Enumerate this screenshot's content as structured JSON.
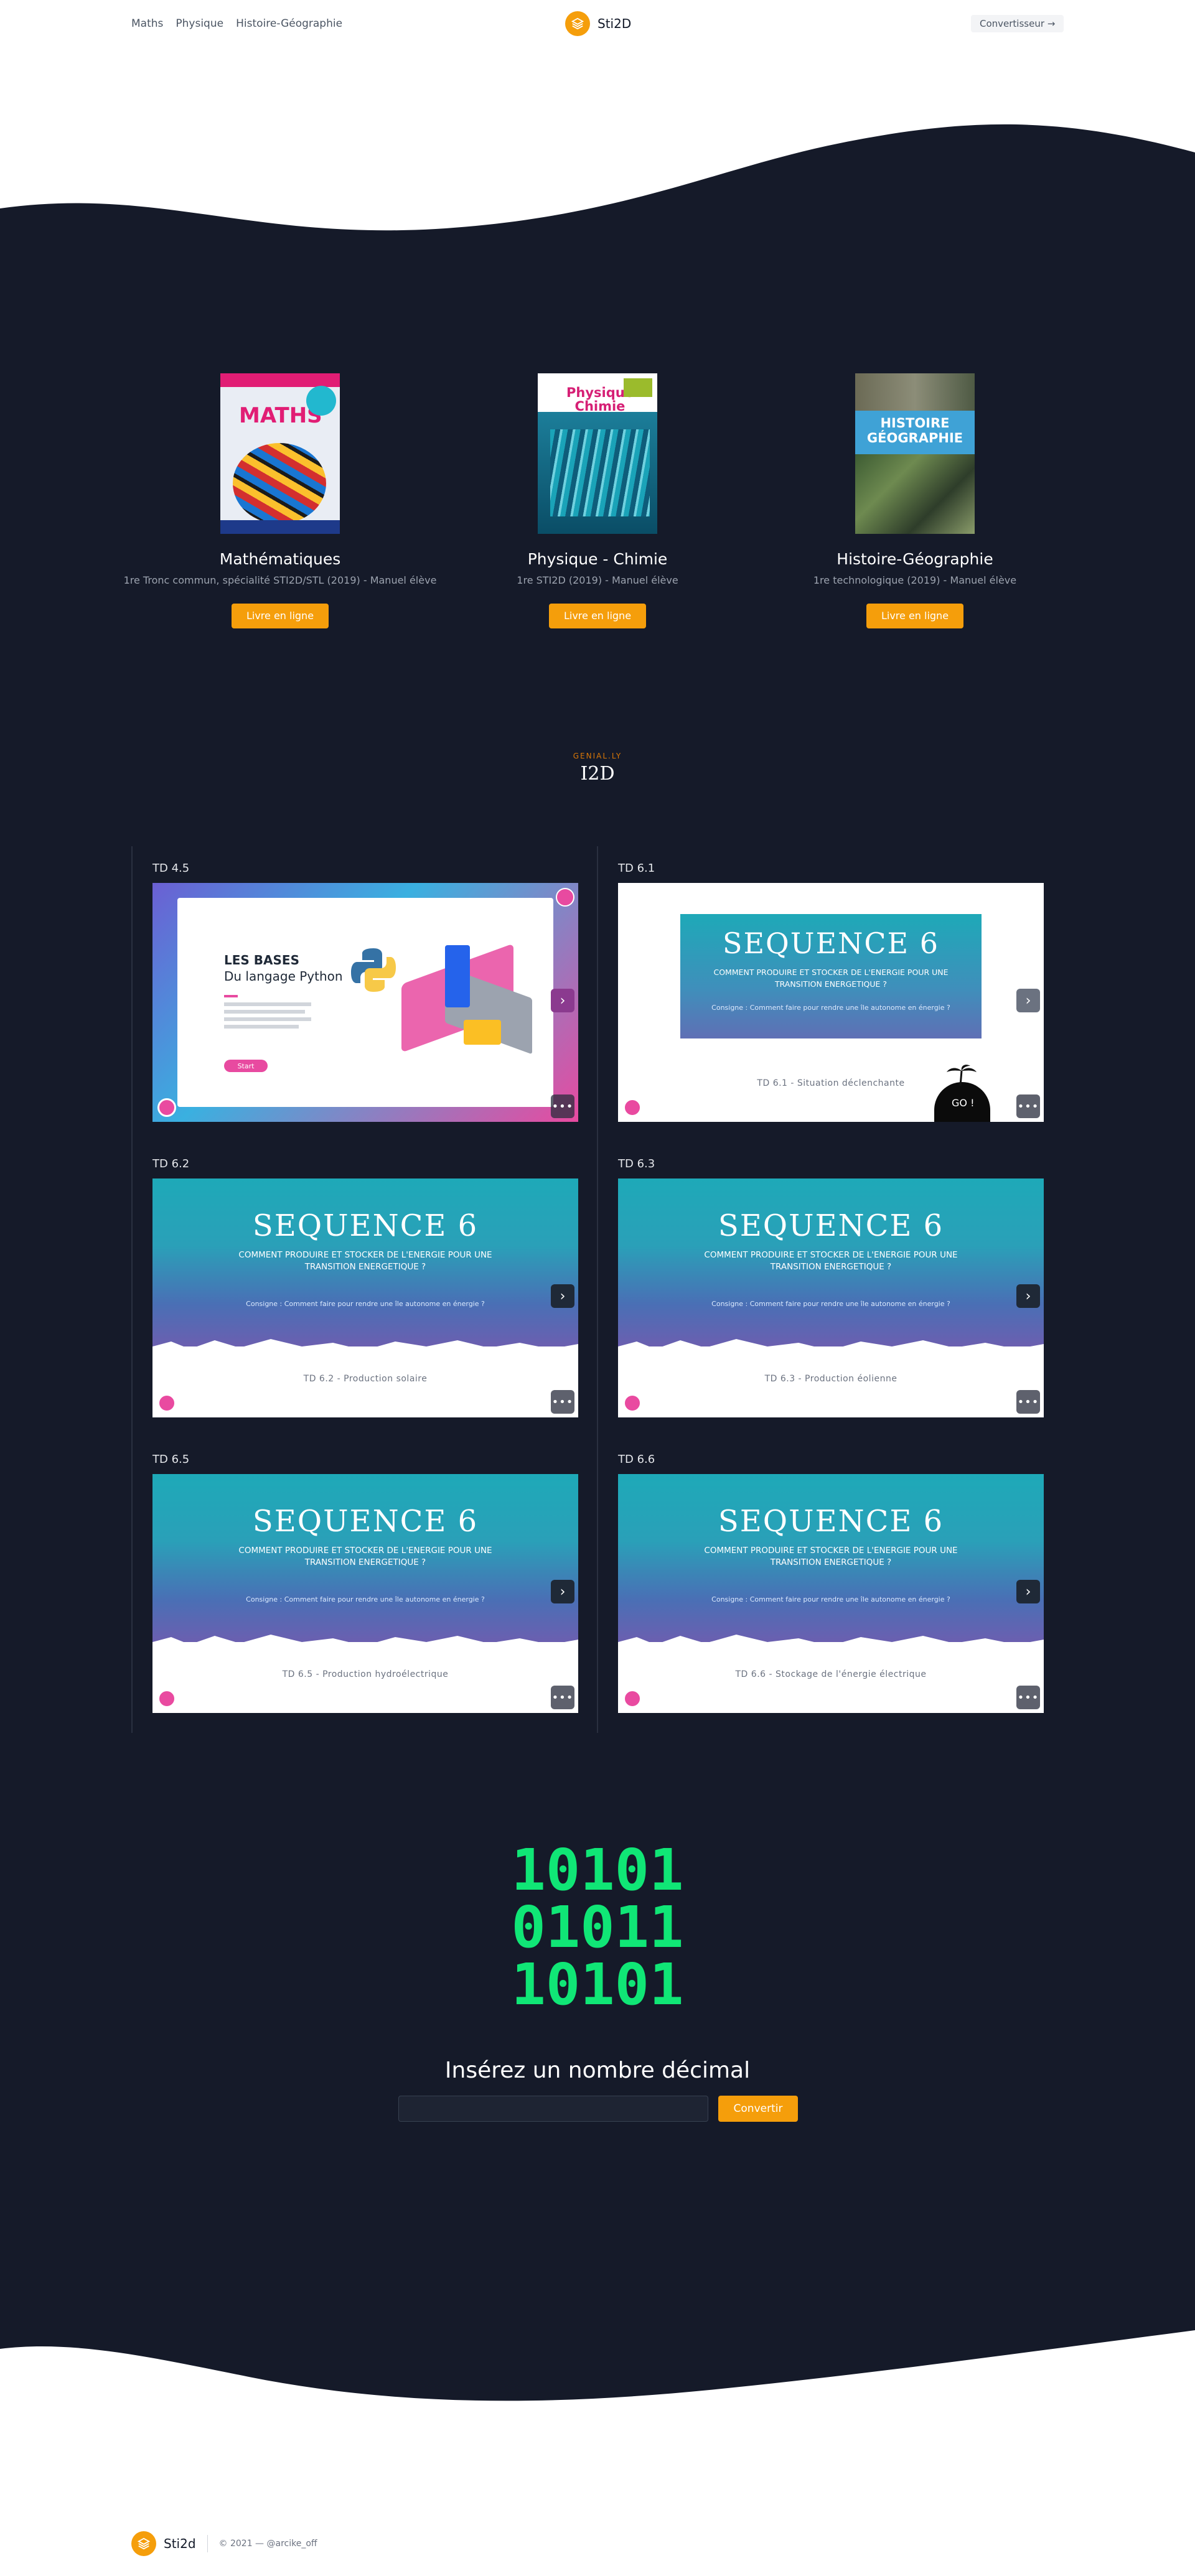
{
  "header": {
    "nav": [
      "Maths",
      "Physique",
      "Histoire-Géographie"
    ],
    "brand": "Sti2D",
    "converter_button": "Convertisseur →"
  },
  "books": [
    {
      "title": "Mathématiques",
      "subtitle": "1re Tronc commun, spécialité STI2D/STL (2019) - Manuel élève",
      "button": "Livre en ligne",
      "cover_text": "MATHS"
    },
    {
      "title": "Physique - Chimie",
      "subtitle": "1re STI2D (2019) - Manuel élève",
      "button": "Livre en ligne",
      "cover_text": "Physique Chimie"
    },
    {
      "title": "Histoire-Géographie",
      "subtitle": "1re technologique (2019) - Manuel élève",
      "button": "Livre en ligne",
      "cover_text": "HISTOIRE GÉOGRAPHIE"
    }
  ],
  "genial": {
    "eyebrow": "GENIAL.LY",
    "title": "I2D"
  },
  "td_cards": [
    {
      "label": "TD 4.5",
      "kind": "python",
      "slide_title": "LES BASES",
      "slide_subtitle": "Du langage Python",
      "slide_button": "Start"
    },
    {
      "label": "TD 6.1",
      "kind": "sequence",
      "seq_title": "SEQUENCE 6",
      "seq_sub": "Comment produire et stocker de l'energie pour une transition energetique ?",
      "seq_q": "Consigne : Comment faire pour rendre une île autonome en énergie ?",
      "footer": "TD 6.1 - Situation déclenchante",
      "go": "GO !"
    },
    {
      "label": "TD 6.2",
      "kind": "sequence",
      "seq_title": "SEQUENCE 6",
      "seq_sub": "Comment produire et stocker de l'energie pour une transition energetique ?",
      "seq_q": "Consigne : Comment faire pour rendre une île autonome en énergie ?",
      "footer": "TD 6.2 - Production solaire"
    },
    {
      "label": "TD 6.3",
      "kind": "sequence",
      "seq_title": "SEQUENCE 6",
      "seq_sub": "Comment produire et stocker de l'energie pour une transition energetique ?",
      "seq_q": "Consigne : Comment faire pour rendre une île autonome en énergie ?",
      "footer": "TD 6.3 - Production éolienne"
    },
    {
      "label": "TD 6.5",
      "kind": "sequence",
      "seq_title": "SEQUENCE 6",
      "seq_sub": "Comment produire et stocker de l'energie pour une transition energetique ?",
      "seq_q": "Consigne : Comment faire pour rendre une île autonome en énergie ?",
      "footer": "TD 6.5 - Production hydroélectrique"
    },
    {
      "label": "TD 6.6",
      "kind": "sequence",
      "seq_title": "SEQUENCE 6",
      "seq_sub": "Comment produire et stocker de l'energie pour une transition energetique ?",
      "seq_q": "Consigne : Comment faire pour rendre une île autonome en énergie ?",
      "footer": "TD 6.6 - Stockage de l'énergie électrique"
    }
  ],
  "converter": {
    "binary_lines": [
      "10101",
      "01011",
      "10101"
    ],
    "title": "Insérez un nombre décimal",
    "input_value": "",
    "button": "Convertir"
  },
  "footer": {
    "brand": "Sti2d",
    "copyright": "© 2021 — @arcike_off"
  },
  "colors": {
    "dark_bg": "#151a29",
    "accent": "#f59e0b",
    "binary": "#10e676"
  }
}
